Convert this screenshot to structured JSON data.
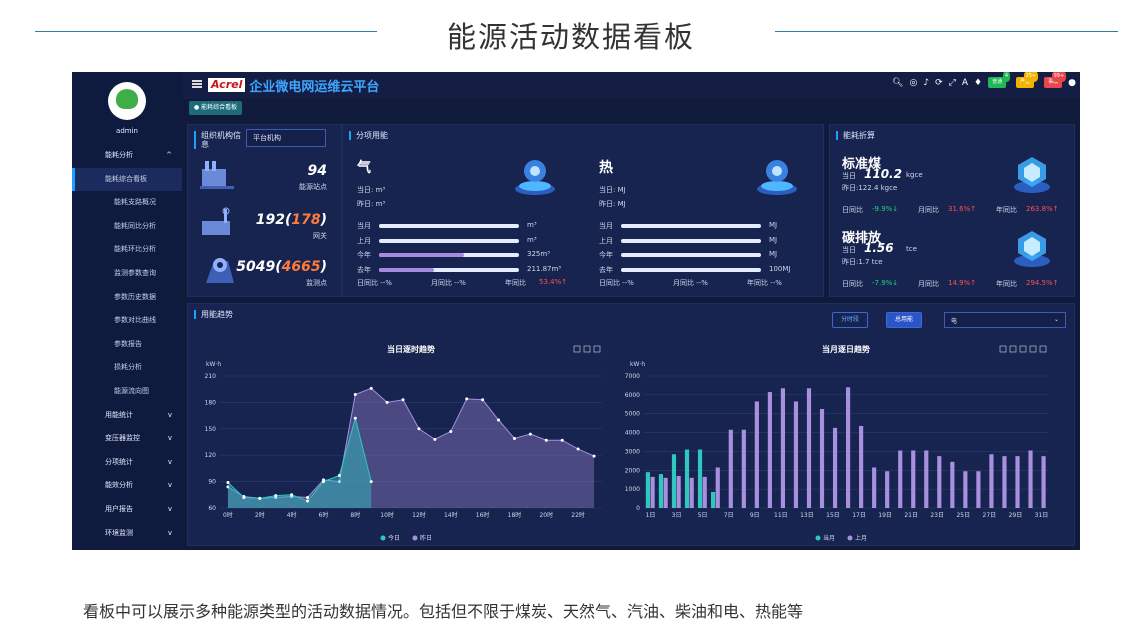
{
  "slide": {
    "title": "能源活动数据看板",
    "caption": "看板中可以展示多种能源类型的活动数据情况。包括但不限于煤炭、天然气、汽油、柴油和电、热能等"
  },
  "sidebar": {
    "user": "admin",
    "items": [
      {
        "label": "能耗分析",
        "type": "top",
        "chev": "^"
      },
      {
        "label": "能耗综合看板",
        "type": "active"
      },
      {
        "label": "能耗支路概况",
        "type": "sub"
      },
      {
        "label": "能耗同比分析",
        "type": "sub"
      },
      {
        "label": "能耗环比分析",
        "type": "sub"
      },
      {
        "label": "监测参数查询",
        "type": "sub"
      },
      {
        "label": "参数历史数据",
        "type": "sub"
      },
      {
        "label": "参数对比曲线",
        "type": "sub"
      },
      {
        "label": "参数报告",
        "type": "sub"
      },
      {
        "label": "损耗分析",
        "type": "sub"
      },
      {
        "label": "能源流向图",
        "type": "sub"
      },
      {
        "label": "用能统计",
        "type": "top",
        "chev": "v"
      },
      {
        "label": "变压器监控",
        "type": "top",
        "chev": "v"
      },
      {
        "label": "分项统计",
        "type": "top",
        "chev": "v"
      },
      {
        "label": "能效分析",
        "type": "top",
        "chev": "v"
      },
      {
        "label": "用户报告",
        "type": "top",
        "chev": "v"
      },
      {
        "label": "环境监测",
        "type": "top",
        "chev": "v"
      }
    ]
  },
  "topbar": {
    "logo": "Acrel",
    "title": "企业微电网运维云平台",
    "tab": "● 能耗综合看板",
    "badges": [
      {
        "label": "普通",
        "count": "4",
        "color": "#1db954"
      },
      {
        "label": "严重",
        "count": "25+",
        "color": "#f0b400"
      },
      {
        "label": "事故",
        "count": "99+",
        "color": "#e8474a"
      }
    ]
  },
  "org": {
    "heading": "组织机构信息",
    "select": "平台机构",
    "stats": [
      {
        "value": "94",
        "extra": "",
        "label": "能源站点"
      },
      {
        "value": "192",
        "extra": "178",
        "label": "网关"
      },
      {
        "value": "5049",
        "extra": "4665",
        "label": "监测点"
      }
    ]
  },
  "energy": {
    "heading": "分项用能",
    "gas": {
      "title": "气",
      "today": "当日: m³",
      "yesterday": "昨日: m³",
      "rows": [
        {
          "label": "当月",
          "value": "m³",
          "fill": 0
        },
        {
          "label": "上月",
          "value": "m³",
          "fill": 0
        },
        {
          "label": "今年",
          "value": "325m³",
          "fill": 0.61
        },
        {
          "label": "去年",
          "value": "211.87m³",
          "fill": 0.39
        }
      ],
      "cmp": [
        "日同比 --%",
        "月同比 --%",
        "年同比"
      ],
      "yoy": "53.4%↑"
    },
    "heat": {
      "title": "热",
      "today": "当日: MJ",
      "yesterday": "昨日: MJ",
      "rows": [
        {
          "label": "当月",
          "value": "MJ",
          "fill": 0
        },
        {
          "label": "上月",
          "value": "MJ",
          "fill": 0
        },
        {
          "label": "今年",
          "value": "MJ",
          "fill": 0
        },
        {
          "label": "去年",
          "value": "100MJ",
          "fill": 0
        }
      ],
      "cmp": [
        "日同比 --%",
        "月同比 --%",
        "年同比 --%"
      ]
    }
  },
  "convert": {
    "heading": "能耗折算",
    "coal": {
      "title": "标准煤",
      "today_label": "当日",
      "today_value": "110.2",
      "unit": "kgce",
      "yesterday": "昨日:122.4 kgce",
      "day": "-9.9%↓",
      "month": "31.6%↑",
      "year": "263.8%↑"
    },
    "carbon": {
      "title": "碳排放",
      "today_label": "当日",
      "today_value": "1.56",
      "unit": "tce",
      "yesterday": "昨日:1.7 tce",
      "day": "-7.9%↓",
      "month": "14.9%↑",
      "year": "294.5%↑"
    },
    "labels": {
      "day": "日同比",
      "month": "月同比",
      "year": "年同比"
    }
  },
  "trend": {
    "heading": "用能趋势",
    "btn_period": "分时段",
    "btn_total": "总用能",
    "select": "电"
  },
  "chart_data": [
    {
      "type": "area",
      "title": "当日逐时趋势",
      "ylabel": "kW·h",
      "ylim": [
        60,
        210
      ],
      "yticks": [
        60,
        90,
        120,
        150,
        180,
        210
      ],
      "x": [
        "0时",
        "1时",
        "2时",
        "3时",
        "4时",
        "5时",
        "6时",
        "7时",
        "8时",
        "9时",
        "10时",
        "11时",
        "12时",
        "13时",
        "14时",
        "15时",
        "16时",
        "17时",
        "18时",
        "19时",
        "20时",
        "21时",
        "22时",
        "23时"
      ],
      "xticks": [
        "0时",
        "2时",
        "4时",
        "6时",
        "8时",
        "10时",
        "12时",
        "14时",
        "16时",
        "18时",
        "20时",
        "22时"
      ],
      "series": [
        {
          "name": "今日",
          "color": "#2fc7c0",
          "values": [
            89,
            72,
            71,
            74,
            75,
            68,
            90,
            97,
            162,
            90
          ]
        },
        {
          "name": "昨日",
          "color": "#a890df",
          "values": [
            84,
            73,
            71,
            72,
            73,
            72,
            92,
            90,
            189,
            196,
            180,
            183,
            150,
            138,
            147,
            184,
            183,
            160,
            139,
            144,
            137,
            137,
            127,
            119
          ]
        }
      ]
    },
    {
      "type": "bar",
      "title": "当月逐日趋势",
      "ylabel": "kW·h",
      "ylim": [
        0,
        7000
      ],
      "yticks": [
        0,
        1000,
        2000,
        3000,
        4000,
        5000,
        6000,
        7000
      ],
      "x": [
        "1日",
        "2日",
        "3日",
        "4日",
        "5日",
        "6日",
        "7日",
        "8日",
        "9日",
        "10日",
        "11日",
        "12日",
        "13日",
        "14日",
        "15日",
        "16日",
        "17日",
        "18日",
        "19日",
        "20日",
        "21日",
        "22日",
        "23日",
        "24日",
        "25日",
        "26日",
        "27日",
        "28日",
        "29日",
        "30日",
        "31日"
      ],
      "xticks": [
        "1日",
        "3日",
        "5日",
        "7日",
        "9日",
        "11日",
        "13日",
        "15日",
        "17日",
        "19日",
        "21日",
        "23日",
        "25日",
        "27日",
        "29日",
        "31日"
      ],
      "series": [
        {
          "name": "当月",
          "color": "#2fc7c0",
          "values": [
            1900,
            1800,
            2850,
            3100,
            3100,
            850,
            null,
            null,
            null,
            null,
            null,
            null,
            null,
            null,
            null,
            null,
            null,
            null,
            null,
            null,
            null,
            null,
            null,
            null,
            null,
            null,
            null,
            null,
            null,
            null,
            null
          ]
        },
        {
          "name": "上月",
          "color": "#a890df",
          "values": [
            1650,
            1600,
            1700,
            1600,
            1650,
            2150,
            4150,
            4150,
            5650,
            6150,
            6350,
            5650,
            6350,
            5250,
            4250,
            6400,
            4350,
            2150,
            1950,
            3050,
            3050,
            3050,
            2750,
            2450,
            1950,
            1950,
            2850,
            2750,
            2750,
            3050,
            2750
          ]
        }
      ]
    }
  ]
}
